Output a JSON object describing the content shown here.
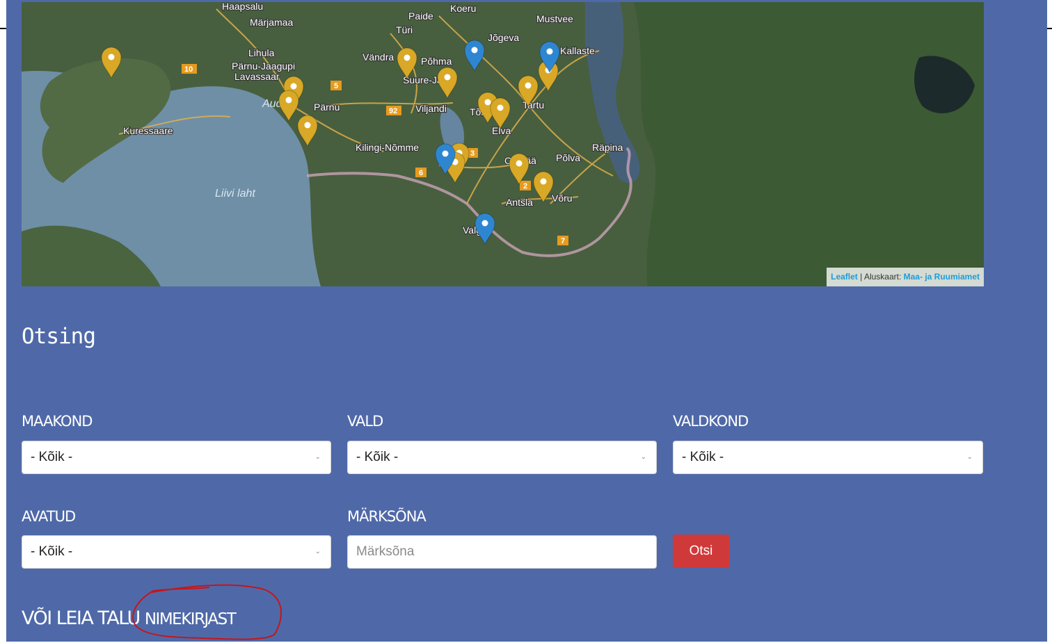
{
  "map": {
    "places": [
      "Haapsalu",
      "Märjamaa",
      "Paide",
      "Koeru",
      "Mustvee",
      "Türi",
      "Jõgeva",
      "Lihula",
      "Vändra",
      "Põhma",
      "Kallaste",
      "Pärnu-Jaagupi",
      "Lavassaar",
      "Suure-Jaani",
      "Pärnu",
      "Viljandi",
      "Tartu",
      "Kuressaare",
      "Tõrva",
      "Elva",
      "Kilingi-Nõmme",
      "Räpina",
      "Otepää",
      "Põlva",
      "Valga",
      "Antsla",
      "Võru",
      "Liivi laht",
      "Aud"
    ],
    "road_numbers": [
      "10",
      "5",
      "92",
      "3",
      "6",
      "2",
      "7"
    ],
    "marker_colors": {
      "gold": "#d8a826",
      "blue": "#2f86d0"
    },
    "attribution": {
      "leaflet": "Leaflet",
      "separator": " | ",
      "prefix": "Aluskaart: ",
      "provider": "Maa- ja Ruumiamet"
    }
  },
  "search": {
    "title": "Otsing",
    "maakond_label": "MAAKOND",
    "maakond_value": "- Kõik -",
    "vald_label": "VALD",
    "vald_value": "- Kõik -",
    "valdkond_label": "VALDKOND",
    "valdkond_value": "- Kõik -",
    "avatud_label": "AVATUD",
    "avatud_value": "- Kõik -",
    "keyword_label": "MÄRKSÕNA",
    "keyword_placeholder": "Märksõna",
    "submit_label": "Otsi"
  },
  "list_link": {
    "prefix": "VÕI LEIA TALU",
    "suffix": "NIMEKIRJAST"
  },
  "colors": {
    "panel": "#4f69a8",
    "button": "#d0393a",
    "annotation": "#c4161c"
  }
}
